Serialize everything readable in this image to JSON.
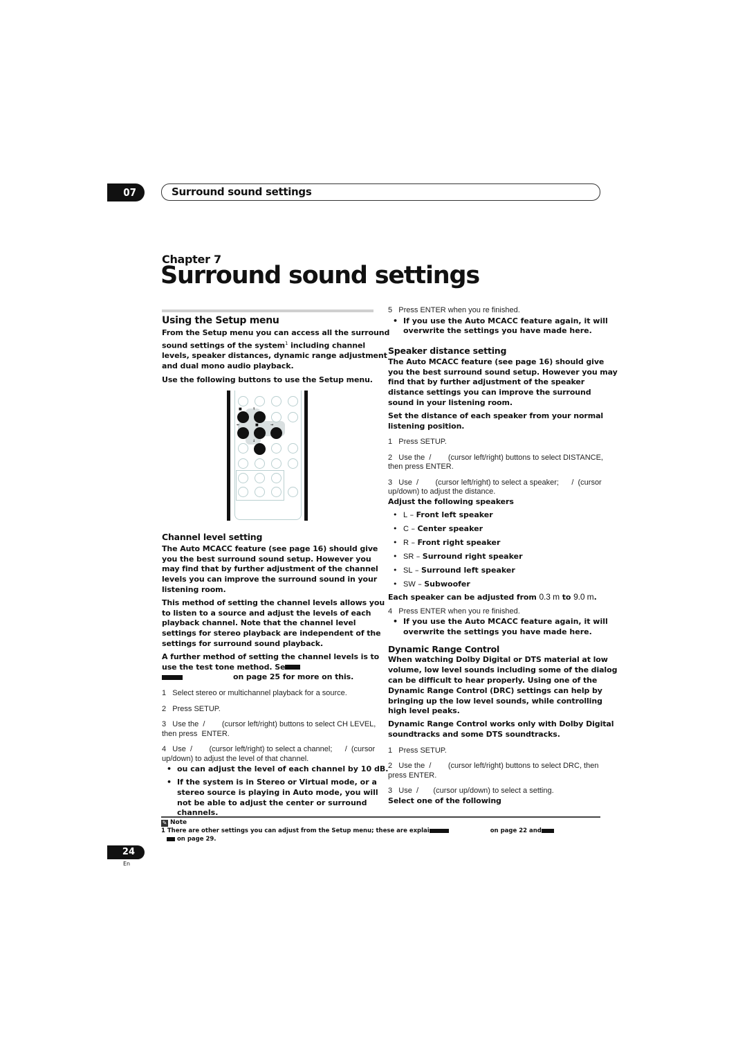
{
  "header": {
    "chapter_number": "07",
    "section_title": "Surround sound settings"
  },
  "chapter": {
    "label": "Chapter 7",
    "title": "Surround sound settings"
  },
  "setup_menu": {
    "heading": "Using the Setup menu",
    "intro_1": "From the Setup menu you can access all the surround sound settings of the system",
    "footnote_ref": "1",
    "intro_2": " including channel levels, speaker distances, dynamic range adjustment and dual mono audio playback.",
    "intro_3": "Use the following buttons to use the Setup menu."
  },
  "remote": {
    "icon": "remote-control-icon",
    "labels": [
      "↑",
      "←",
      "■",
      "→",
      "↓"
    ]
  },
  "channel_level": {
    "heading": "Channel level setting",
    "para_1": "The Auto MCACC feature (see page 16) should give you the best surround sound setup. However you may find that by further adjustment of the channel levels you can improve the surround sound in your listening room.",
    "para_2": "This method of setting the channel levels allows you to listen to a source and adjust the levels of each playback channel. Note that the channel level settings for stereo playback are independent of the settings for surround sound playback.",
    "para_3a": "A further method of setting the channel levels is to use the test tone method. Se",
    "para_3b": "on page 25 for more on this.",
    "steps": [
      {
        "num": "1",
        "text": "Select stereo or multichannel playback for a source."
      },
      {
        "num": "2",
        "text": "Press SETUP."
      },
      {
        "num": "3",
        "text": "Use the  /        (cursor left/right) buttons to select CH LEVEL, then press  ENTER."
      },
      {
        "num": "4",
        "text": "Use  /        (cursor left/right) to select a channel;      /  (cursor up/down) to adjust the level of that channel."
      }
    ],
    "bullets": [
      "ou can adjust the level of each channel by  10 dB.",
      "If the system is in Stereo or Virtual mode, or a stereo source is playing in Auto mode, you will not be able to adjust the center or surround channels."
    ],
    "step_5": {
      "num": "5",
      "text": "Press ENTER when you re finished."
    },
    "step_5_bullet": "If you use the Auto MCACC feature again, it will overwrite the settings you have made here."
  },
  "speaker_distance": {
    "heading": "Speaker distance setting",
    "para_1": "The Auto MCACC feature (see page 16) should give you the best surround sound setup. However you may find that by further adjustment of the speaker distance settings you can improve the surround sound in your listening room.",
    "para_2": "Set the distance of each speaker from your normal listening position.",
    "steps": [
      {
        "num": "1",
        "text": "Press SETUP."
      },
      {
        "num": "2",
        "text": "Use the  /        (cursor left/right) buttons to select DISTANCE, then press ENTER."
      },
      {
        "num": "3",
        "text": "Use  /        (cursor left/right) to select a speaker;      /  (cursor up/down) to adjust the distance."
      }
    ],
    "list_heading": "Adjust the following speakers",
    "speakers": [
      {
        "code": "L",
        "desc": "Front left speaker"
      },
      {
        "code": "C",
        "desc": "Center speaker"
      },
      {
        "code": "R",
        "desc": "Front right speaker"
      },
      {
        "code": "SR",
        "desc": "Surround right speaker"
      },
      {
        "code": "SL",
        "desc": "Surround left speaker"
      },
      {
        "code": "SW",
        "desc": "Subwoofer"
      }
    ],
    "range_label": "Each speaker can be adjusted from",
    "range_min": "0.3 m",
    "range_to": " to ",
    "range_max": "9.0 m",
    "step_4": {
      "num": "4",
      "text": "Press ENTER when you re finished."
    },
    "step_4_bullet": "If you use the Auto MCACC feature again, it will overwrite the settings you have made here."
  },
  "drc": {
    "heading": "Dynamic Range Control",
    "para_1": "When watching Dolby Digital or DTS material at low volume, low level sounds including some of the dialog can be difficult to hear properly. Using one of the Dynamic Range Control (DRC) settings can help by bringing up the low level sounds, while controlling high level peaks.",
    "para_2": "Dynamic Range Control works only with Dolby Digital soundtracks and some DTS soundtracks.",
    "steps": [
      {
        "num": "1",
        "text": "Press SETUP."
      },
      {
        "num": "2",
        "text": "Use the  /        (cursor left/right) buttons to select DRC, then press ENTER."
      },
      {
        "num": "3",
        "text": "Use  /       (cursor up/down) to select a setting."
      }
    ],
    "list_heading": "Select one of the following"
  },
  "note": {
    "icon": "pencil-note-icon",
    "label": "Note",
    "text_1": "1 There are other settings you can adjust from the Setup menu; these are explai",
    "text_2": "on page 22 and",
    "text_3": "on page 29."
  },
  "footer": {
    "page_number": "24",
    "language": "En"
  }
}
